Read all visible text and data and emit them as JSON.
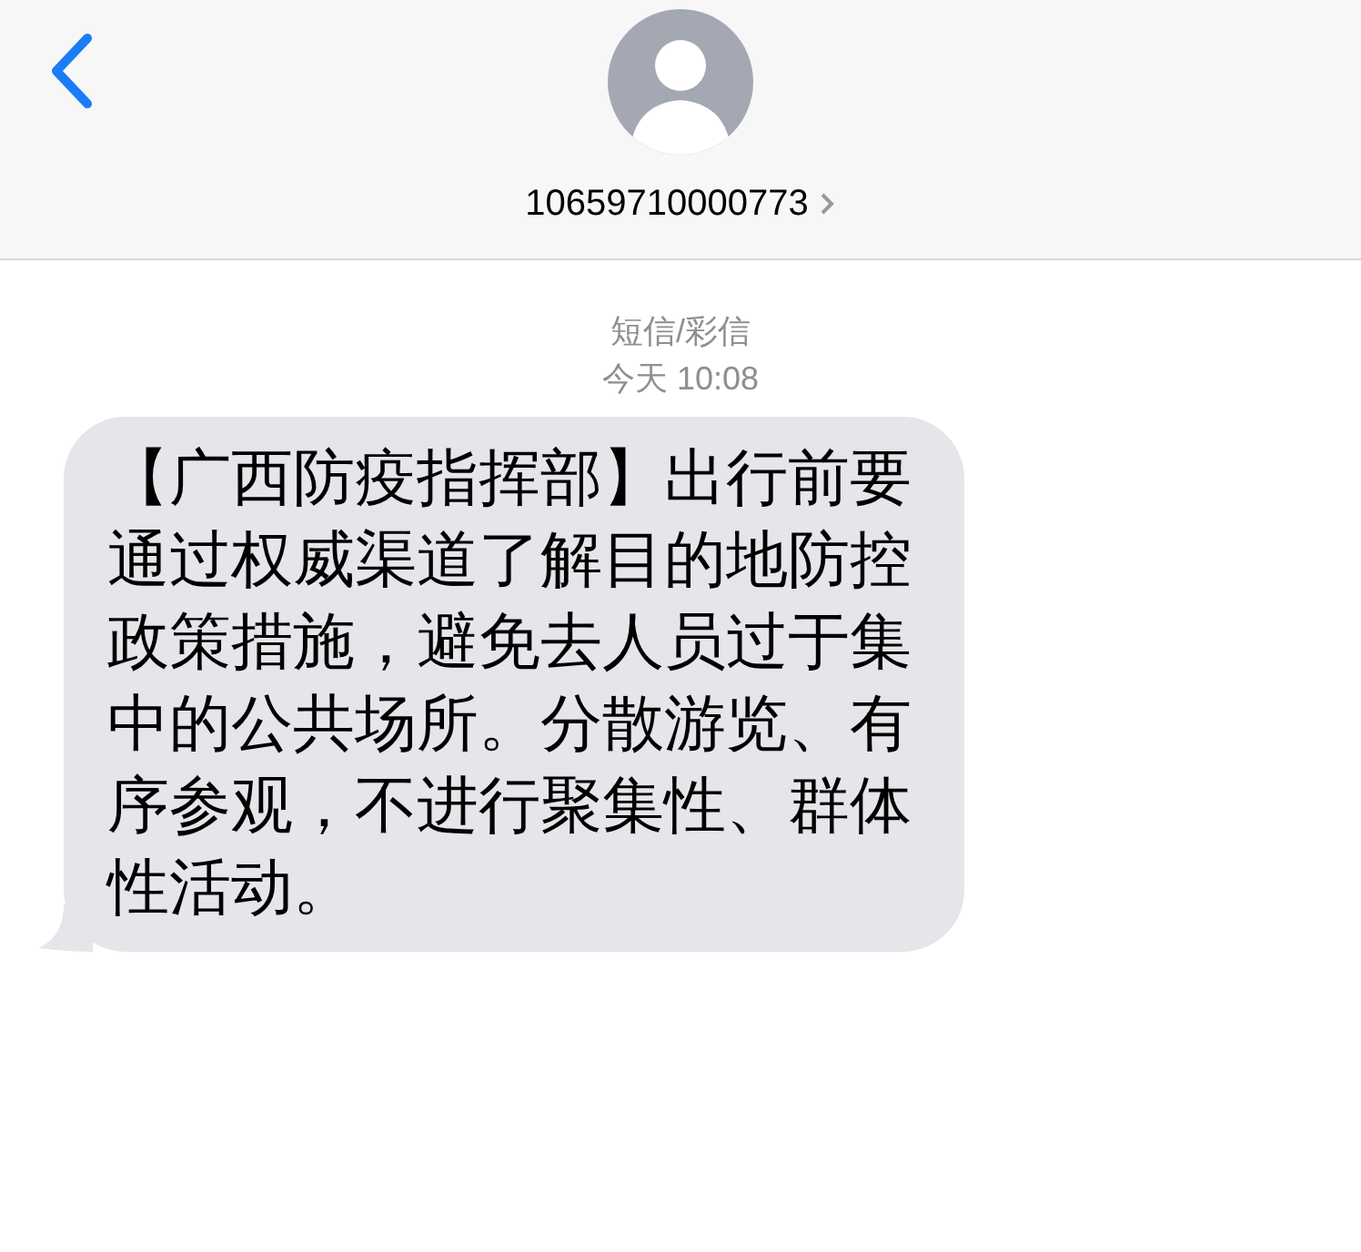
{
  "header": {
    "contact": "10659710000773"
  },
  "meta": {
    "service": "短信/彩信",
    "timestamp": "今天 10:08"
  },
  "messages": [
    {
      "kind": "incoming",
      "text": "【广西防疫指挥部】出行前要通过权威渠道了解目的地防控政策措施，避免去人员过于集中的公共场所。分散游览、有序参观，不进行聚集性、群体性活动。"
    }
  ]
}
